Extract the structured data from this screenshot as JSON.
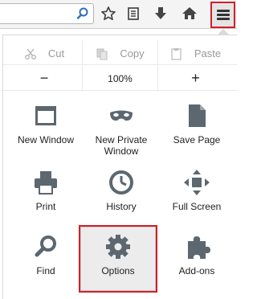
{
  "toolbar": {
    "search_icon": "search-icon",
    "bookmark_icon": "star-icon",
    "reading_list_icon": "bookmarks-menu-icon",
    "download_icon": "download-icon",
    "home_icon": "home-icon",
    "menu_icon": "hamburger-menu-icon"
  },
  "edit": {
    "cut_label": "Cut",
    "copy_label": "Copy",
    "paste_label": "Paste"
  },
  "zoom": {
    "minus_label": "−",
    "value": "100%",
    "plus_label": "+"
  },
  "tiles": [
    {
      "label": "New Window",
      "icon": "new-window-icon"
    },
    {
      "label": "New Private Window",
      "icon": "private-mask-icon"
    },
    {
      "label": "Save Page",
      "icon": "save-page-icon"
    },
    {
      "label": "Print",
      "icon": "printer-icon"
    },
    {
      "label": "History",
      "icon": "clock-icon"
    },
    {
      "label": "Full Screen",
      "icon": "fullscreen-icon"
    },
    {
      "label": "Find",
      "icon": "magnifier-icon"
    },
    {
      "label": "Options",
      "icon": "gear-icon"
    },
    {
      "label": "Add-ons",
      "icon": "puzzle-icon"
    }
  ],
  "colors": {
    "highlight_border": "#d0202a",
    "icon_gray": "#5c6770",
    "disabled_gray": "#9a9a9a"
  }
}
